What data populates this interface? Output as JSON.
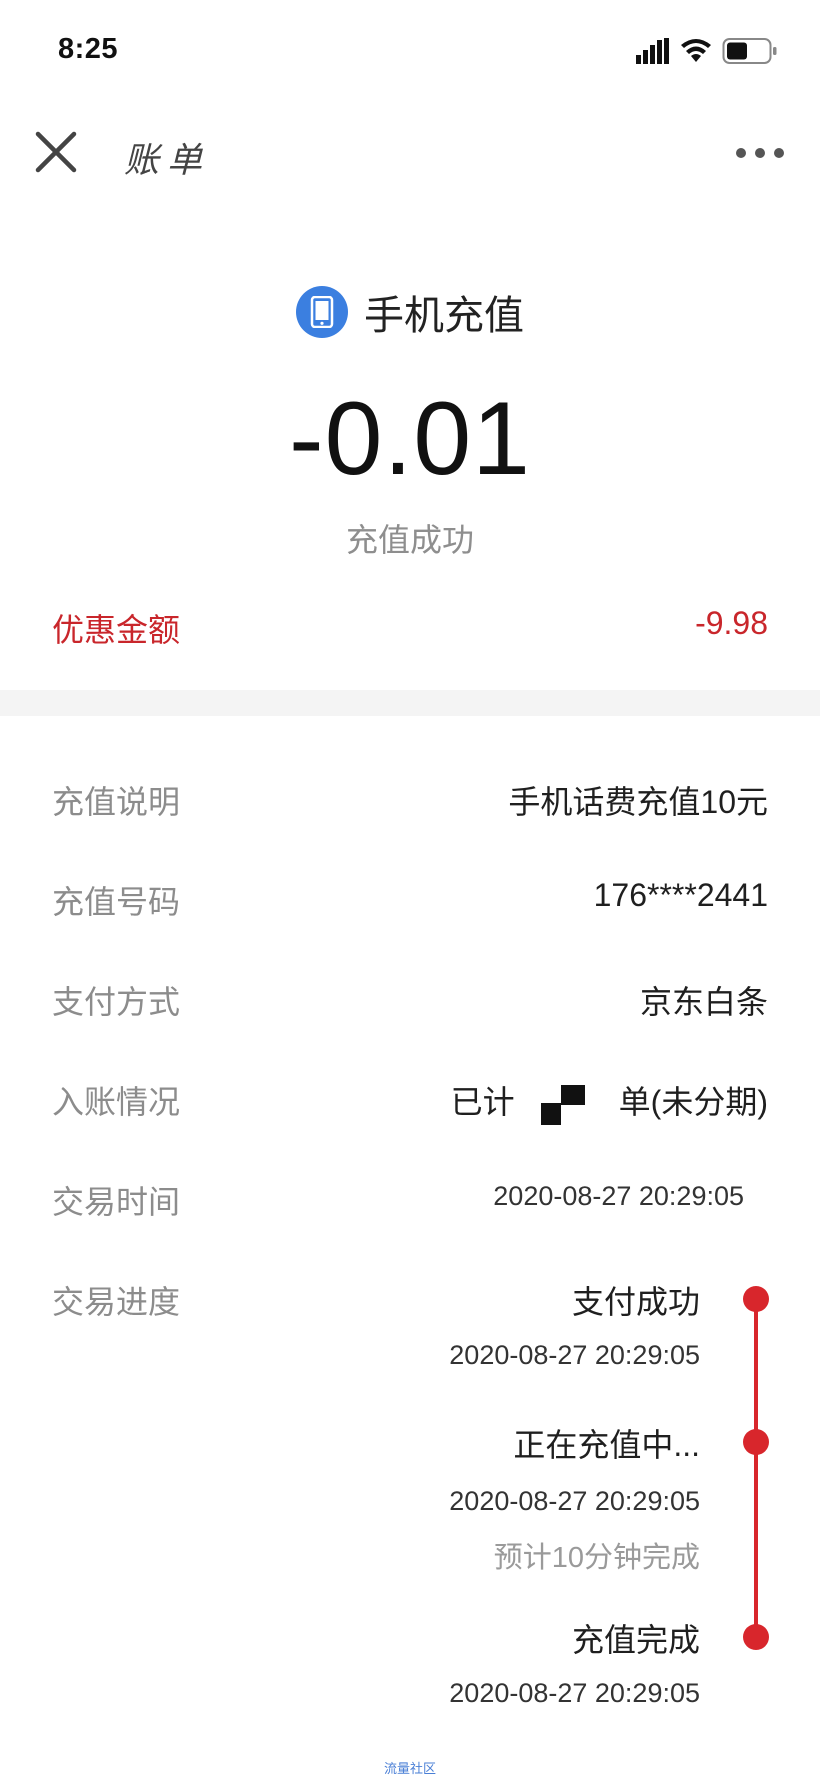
{
  "status_bar": {
    "time": "8:25",
    "icons": [
      "signal-icon",
      "wifi-icon",
      "battery-icon"
    ]
  },
  "nav": {
    "title": "账单",
    "close_icon": "close-icon",
    "more_icon": "more-icon"
  },
  "summary": {
    "merchant_icon": "phone-icon",
    "merchant": "手机充值",
    "amount": "-0.01",
    "status": "充值成功",
    "discount_label": "优惠金额",
    "discount_value": "-9.98"
  },
  "details": {
    "description_label": "充值说明",
    "description_value": "手机话费充值10元",
    "number_label": "充值号码",
    "number_value": "176****2441",
    "payment_label": "支付方式",
    "payment_value": "京东白条",
    "posting_label": "入账情况",
    "posting_value_prefix": "已计",
    "posting_value_suffix": "单(未分期)",
    "time_label": "交易时间",
    "time_value": "2020-08-27 20:29:05",
    "progress_label": "交易进度"
  },
  "progress": [
    {
      "title": "支付成功",
      "time": "2020-08-27 20:29:05"
    },
    {
      "title": "正在充值中...",
      "time": "2020-08-27 20:29:05",
      "note": "预计10分钟完成"
    },
    {
      "title": "充值完成",
      "time": "2020-08-27 20:29:05"
    }
  ],
  "colors": {
    "accent_red": "#d8262c",
    "discount_red": "#c9262b",
    "icon_blue": "#3b7fe0"
  },
  "watermark": "流量社区"
}
